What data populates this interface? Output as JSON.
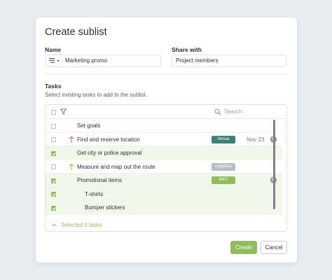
{
  "dialog": {
    "title": "Create sublist",
    "name_label": "Name",
    "name_value": "Marketing promo",
    "share_label": "Share with",
    "share_value": "Project members",
    "tasks_label": "Tasks",
    "tasks_subtitle": "Select existing tasks to add to the sublist."
  },
  "table": {
    "search_placeholder": "Search",
    "rows": [
      {
        "label": "Set goals",
        "checked": false,
        "priority": "",
        "tag": "",
        "tag_color": "",
        "date": "",
        "avatar": false,
        "indent": 0
      },
      {
        "label": "Find and reserve location",
        "checked": false,
        "priority": "high",
        "tag": "Venue",
        "tag_color": "#3e7f79",
        "date": "Nov 23",
        "avatar": true,
        "indent": 0
      },
      {
        "label": "Get city or police approval",
        "checked": true,
        "priority": "",
        "tag": "",
        "tag_color": "",
        "date": "",
        "avatar": false,
        "indent": 0
      },
      {
        "label": "Measure and map out the route",
        "checked": false,
        "priority": "medium",
        "tag": "Logistics",
        "tag_color": "#b9bec5",
        "date": "",
        "avatar": false,
        "indent": 0
      },
      {
        "label": "Promotional items",
        "checked": true,
        "priority": "",
        "tag": "MKT",
        "tag_color": "#8fbe5a",
        "date": "",
        "avatar": true,
        "indent": 0
      },
      {
        "label": "T-shirts",
        "checked": true,
        "priority": "",
        "tag": "",
        "tag_color": "",
        "date": "",
        "avatar": false,
        "indent": 1
      },
      {
        "label": "Bumper stickers",
        "checked": true,
        "priority": "",
        "tag": "",
        "tag_color": "",
        "date": "",
        "avatar": false,
        "indent": 1
      }
    ],
    "selected_text": "Selected 5 tasks"
  },
  "buttons": {
    "create": "Create",
    "cancel": "Cancel"
  },
  "colors": {
    "accent": "#8fbe5a",
    "priority_high": "#e8736a",
    "priority_medium": "#f0a43a"
  },
  "icons": {
    "text_format": "text-format-icon",
    "filter": "filter-icon",
    "search": "search-icon",
    "collapse": "chevron-up-icon"
  }
}
